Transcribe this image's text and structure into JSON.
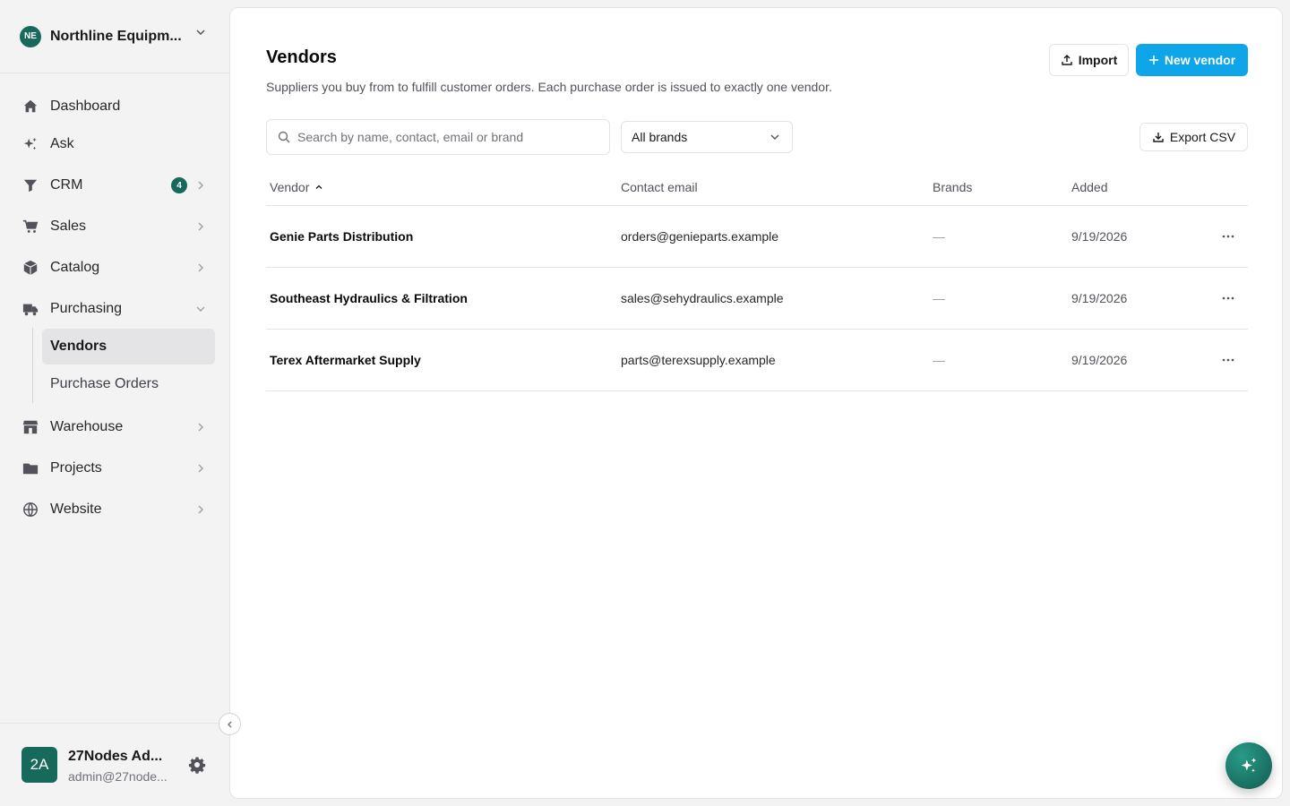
{
  "org": {
    "initials": "NE",
    "name": "Northline Equipm..."
  },
  "nav": {
    "dashboard": "Dashboard",
    "ask": "Ask",
    "crm": "CRM",
    "crm_badge": "4",
    "sales": "Sales",
    "catalog": "Catalog",
    "purchasing": "Purchasing",
    "vendors": "Vendors",
    "purchase_orders": "Purchase Orders",
    "warehouse": "Warehouse",
    "projects": "Projects",
    "website": "Website"
  },
  "user": {
    "initials": "2A",
    "name": "27Nodes Ad...",
    "email": "admin@27node..."
  },
  "page": {
    "title": "Vendors",
    "description": "Suppliers you buy from to fulfill customer orders. Each purchase order is issued to exactly one vendor.",
    "import_label": "Import",
    "new_vendor_label": "New vendor",
    "export_label": "Export CSV"
  },
  "search": {
    "placeholder": "Search by name, contact, email or brand",
    "value": ""
  },
  "brand_filter": {
    "selected": "All brands"
  },
  "table": {
    "columns": {
      "vendor": "Vendor",
      "email": "Contact email",
      "brands": "Brands",
      "added": "Added"
    },
    "rows": [
      {
        "vendor": "Genie Parts Distribution",
        "email": "orders@genieparts.example",
        "brands": "—",
        "added": "9/19/2026"
      },
      {
        "vendor": "Southeast Hydraulics & Filtration",
        "email": "sales@sehydraulics.example",
        "brands": "—",
        "added": "9/19/2026"
      },
      {
        "vendor": "Terex Aftermarket Supply",
        "email": "parts@terexsupply.example",
        "brands": "—",
        "added": "9/19/2026"
      }
    ]
  },
  "colors": {
    "primary": "#0ea5e9",
    "brand_green": "#17695b",
    "sidebar_bg": "#f3f3f4"
  }
}
